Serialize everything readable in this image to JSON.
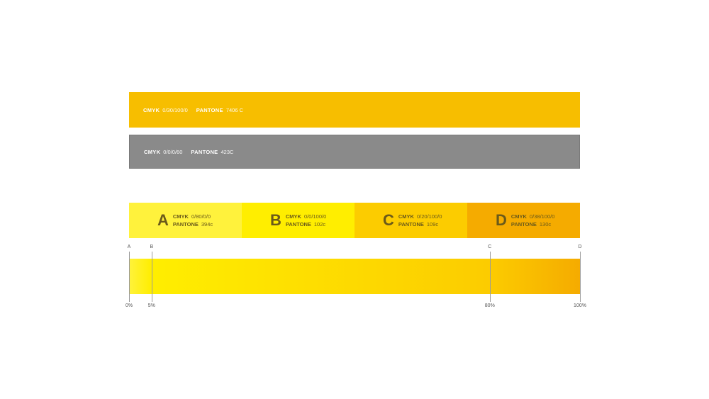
{
  "primary": {
    "cmyk_label": "CMYK",
    "cmyk_value": "0/30/100/0",
    "pantone_label": "PANTONE",
    "pantone_value": "7406 C",
    "color": "#f7be00"
  },
  "secondary": {
    "cmyk_label": "CMYK",
    "cmyk_value": "0/0/0/60",
    "pantone_label": "PANTONE",
    "pantone_value": "423C",
    "color": "#8a8a8a"
  },
  "swatches": [
    {
      "letter": "A",
      "cmyk_label": "CMYK",
      "cmyk_value": "0/80/0/0",
      "pantone_label": "PANTONE",
      "pantone_value": "394c",
      "color": "#fff23c"
    },
    {
      "letter": "B",
      "cmyk_label": "CMYK",
      "cmyk_value": "0/0/100/0",
      "pantone_label": "PANTONE",
      "pantone_value": "102c",
      "color": "#ffee00"
    },
    {
      "letter": "C",
      "cmyk_label": "CMYK",
      "cmyk_value": "0/20/100/0",
      "pantone_label": "PANTONE",
      "pantone_value": "109c",
      "color": "#fccc00"
    },
    {
      "letter": "D",
      "cmyk_label": "CMYK",
      "cmyk_value": "0/38/100/0",
      "pantone_label": "PANTONE",
      "pantone_value": "130c",
      "color": "#f5ab00"
    }
  ],
  "gradient_stops": [
    {
      "letter": "A",
      "percent_label": "0%",
      "position": 0
    },
    {
      "letter": "B",
      "percent_label": "5%",
      "position": 0.05
    },
    {
      "letter": "C",
      "percent_label": "80%",
      "position": 0.8
    },
    {
      "letter": "D",
      "percent_label": "100%",
      "position": 1
    }
  ]
}
